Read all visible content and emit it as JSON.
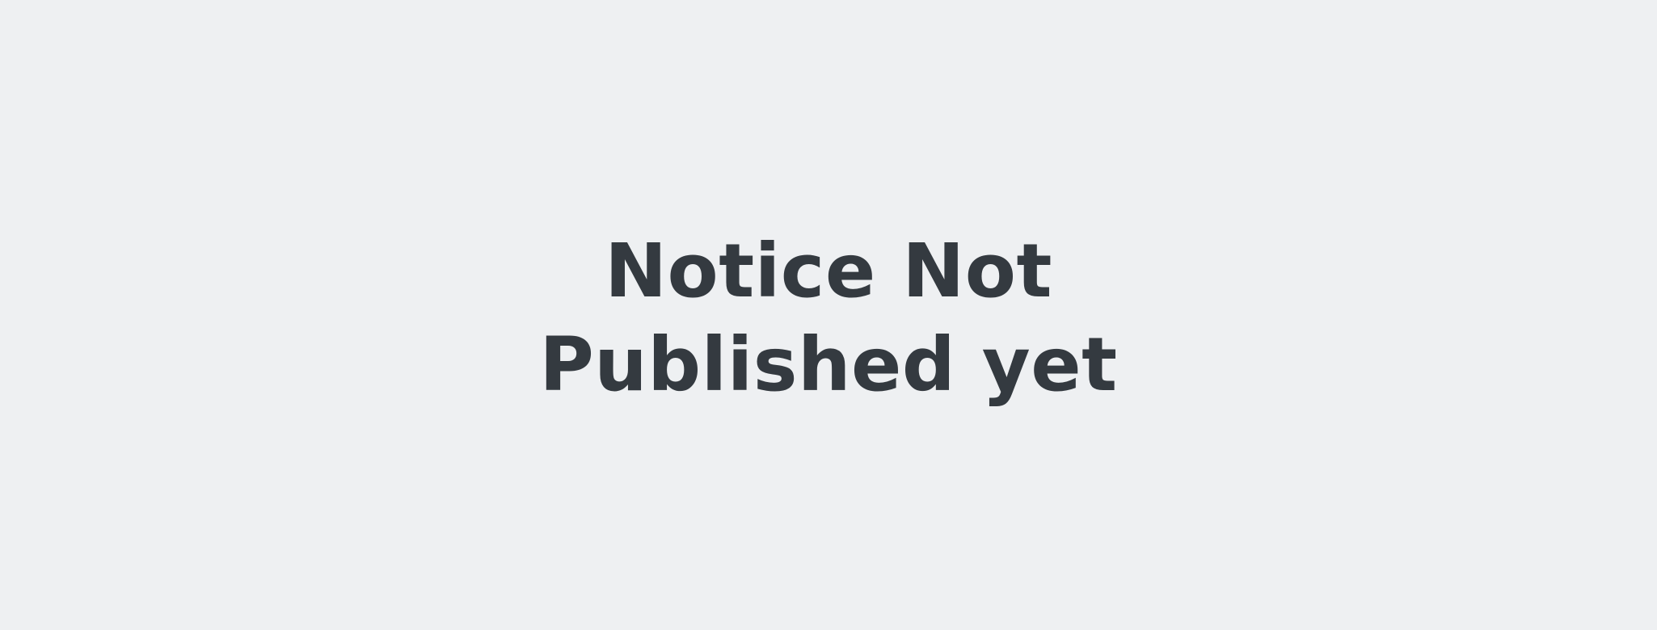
{
  "notice": {
    "line1": "Notice Not",
    "line2": "Published yet"
  },
  "colors": {
    "background": "#eef0f2",
    "text": "#343a40"
  }
}
